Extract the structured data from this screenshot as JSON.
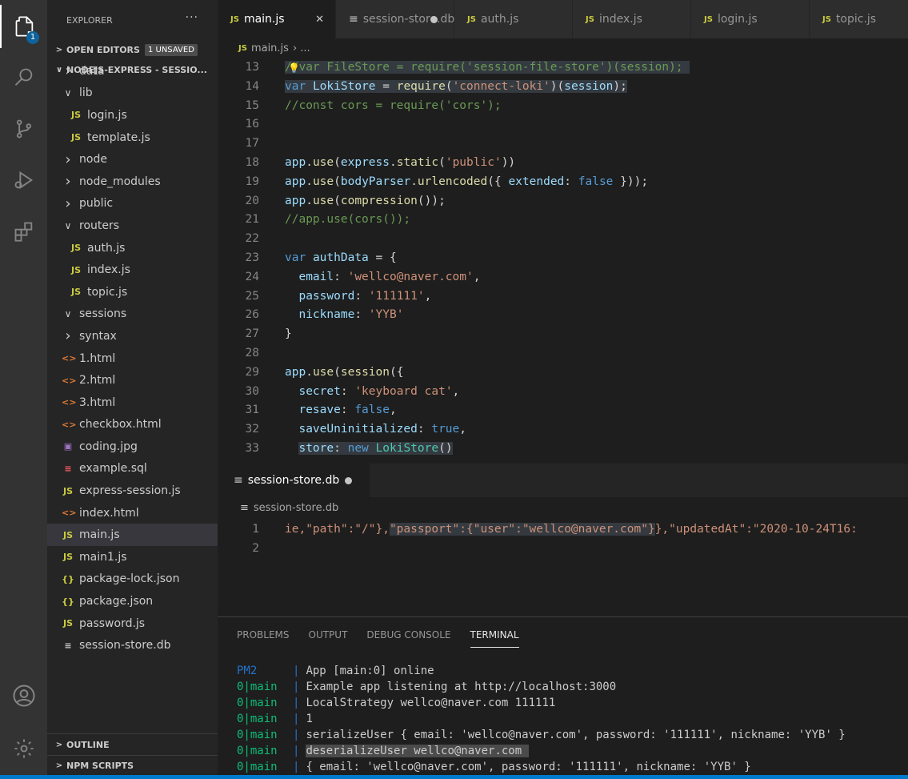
{
  "activity": {
    "explorer_badge": "1"
  },
  "sidebar": {
    "title": "EXPLORER",
    "more": "···",
    "open_editors": {
      "label": "OPEN EDITORS",
      "badge": "1 UNSAVED"
    },
    "project": {
      "label": "NODEJS-EXPRESS - SESSIO..."
    },
    "tree": [
      {
        "label": "data",
        "kind": "folder-closed",
        "depth": 1
      },
      {
        "label": "lib",
        "kind": "folder-open",
        "depth": 1
      },
      {
        "label": "login.js",
        "kind": "js",
        "depth": 2
      },
      {
        "label": "template.js",
        "kind": "js",
        "depth": 2
      },
      {
        "label": "node",
        "kind": "folder-closed",
        "depth": 1
      },
      {
        "label": "node_modules",
        "kind": "folder-closed",
        "depth": 1
      },
      {
        "label": "public",
        "kind": "folder-closed",
        "depth": 1
      },
      {
        "label": "routers",
        "kind": "folder-open",
        "depth": 1
      },
      {
        "label": "auth.js",
        "kind": "js",
        "depth": 2
      },
      {
        "label": "index.js",
        "kind": "js",
        "depth": 2
      },
      {
        "label": "topic.js",
        "kind": "js",
        "depth": 2
      },
      {
        "label": "sessions",
        "kind": "folder-open",
        "depth": 1
      },
      {
        "label": "syntax",
        "kind": "folder-closed",
        "depth": 1
      },
      {
        "label": "1.html",
        "kind": "html",
        "depth": 1
      },
      {
        "label": "2.html",
        "kind": "html",
        "depth": 1
      },
      {
        "label": "3.html",
        "kind": "html",
        "depth": 1
      },
      {
        "label": "checkbox.html",
        "kind": "html",
        "depth": 1
      },
      {
        "label": "coding.jpg",
        "kind": "img",
        "depth": 1
      },
      {
        "label": "example.sql",
        "kind": "sql",
        "depth": 1
      },
      {
        "label": "express-session.js",
        "kind": "js",
        "depth": 1
      },
      {
        "label": "index.html",
        "kind": "html",
        "depth": 1
      },
      {
        "label": "main.js",
        "kind": "js",
        "depth": 1,
        "selected": true
      },
      {
        "label": "main1.js",
        "kind": "js",
        "depth": 1
      },
      {
        "label": "package-lock.json",
        "kind": "json",
        "depth": 1
      },
      {
        "label": "package.json",
        "kind": "json",
        "depth": 1
      },
      {
        "label": "password.js",
        "kind": "js",
        "depth": 1
      },
      {
        "label": "session-store.db",
        "kind": "db",
        "depth": 1
      }
    ],
    "outline": "OUTLINE",
    "npm_scripts": "NPM SCRIPTS"
  },
  "tabs": [
    {
      "label": "main.js",
      "icon": "JS",
      "active": true,
      "state": "close"
    },
    {
      "label": "session-store.db",
      "icon": "≡",
      "active": false,
      "state": "dirty"
    },
    {
      "label": "auth.js",
      "icon": "JS",
      "active": false
    },
    {
      "label": "index.js",
      "icon": "JS",
      "active": false
    },
    {
      "label": "login.js",
      "icon": "JS",
      "active": false
    },
    {
      "label": "topic.js",
      "icon": "JS",
      "active": false
    }
  ],
  "breadcrumb": {
    "icon": "JS",
    "file": "main.js",
    "tail": "› ..."
  },
  "editor": {
    "lines": [
      {
        "n": "13",
        "html": "<span class=\"hl\"><span class=\"cm\">//var FileStore = require('session-file-store')(session);</span> </span>"
      },
      {
        "n": "14",
        "html": "<span class=\"hl\"><span class=\"kw\">var</span> <span class=\"prop\">LokiStore</span> = <span class=\"fn\">require</span>(<span class=\"str\">'connect-loki'</span>)(<span class=\"prop\">session</span>);</span>"
      },
      {
        "n": "15",
        "html": "<span class=\"cm\">//const cors = require('cors');</span>"
      },
      {
        "n": "16",
        "html": ""
      },
      {
        "n": "17",
        "html": ""
      },
      {
        "n": "18",
        "html": "<span class=\"prop\">app</span>.<span class=\"fn\">use</span>(<span class=\"prop\">express</span>.<span class=\"fn\">static</span>(<span class=\"str\">'public'</span>))"
      },
      {
        "n": "19",
        "html": "<span class=\"prop\">app</span>.<span class=\"fn\">use</span>(<span class=\"prop\">bodyParser</span>.<span class=\"fn\">urlencoded</span>({ <span class=\"prop\">extended</span>: <span class=\"kw\">false</span> }));"
      },
      {
        "n": "20",
        "html": "<span class=\"prop\">app</span>.<span class=\"fn\">use</span>(<span class=\"fn\">compression</span>());"
      },
      {
        "n": "21",
        "html": "<span class=\"cm\">//app.use(cors());</span>"
      },
      {
        "n": "22",
        "html": ""
      },
      {
        "n": "23",
        "html": "<span class=\"kw\">var</span> <span class=\"prop\">authData</span> = {"
      },
      {
        "n": "24",
        "html": "  <span class=\"prop\">email</span>: <span class=\"str\">'wellco@naver.com'</span>,"
      },
      {
        "n": "25",
        "html": "  <span class=\"prop\">password</span>: <span class=\"str\">'111111'</span>,"
      },
      {
        "n": "26",
        "html": "  <span class=\"prop\">nickname</span>: <span class=\"str\">'YYB'</span>"
      },
      {
        "n": "27",
        "html": "}"
      },
      {
        "n": "28",
        "html": ""
      },
      {
        "n": "29",
        "html": "<span class=\"prop\">app</span>.<span class=\"fn\">use</span>(<span class=\"fn\">session</span>({"
      },
      {
        "n": "30",
        "html": "  <span class=\"prop\">secret</span>: <span class=\"str\">'keyboard cat'</span>,"
      },
      {
        "n": "31",
        "html": "  <span class=\"prop\">resave</span>: <span class=\"kw\">false</span>,"
      },
      {
        "n": "32",
        "html": "  <span class=\"prop\">saveUninitialized</span>: <span class=\"kw\">true</span>,"
      },
      {
        "n": "33",
        "html": "  <span class=\"hl\"><span class=\"prop\">store</span>: <span class=\"kw\">new</span> <span class=\"cls\">LokiStore</span>()</span>"
      }
    ]
  },
  "editor2": {
    "tab": {
      "icon": "≡",
      "label": "session-store.db"
    },
    "breadcrumb": {
      "icon": "≡",
      "file": "session-store.db"
    },
    "lines": [
      {
        "n": "1",
        "html": "<span class=\"jstr\">ie,\"path\":\"/\"},</span><span class=\"hl\"><span class=\"jstr\">\"passport\":{\"user\":\"wellco@naver.com\"}</span></span><span class=\"jstr\">},\"updatedAt\":\"2020-10-24T16:</span>"
      },
      {
        "n": "2",
        "html": ""
      }
    ]
  },
  "panel": {
    "tabs": [
      {
        "label": "PROBLEMS",
        "active": false
      },
      {
        "label": "OUTPUT",
        "active": false
      },
      {
        "label": "DEBUG CONSOLE",
        "active": false
      },
      {
        "label": "TERMINAL",
        "active": true
      }
    ],
    "terminal": [
      {
        "prefix": "PM2",
        "text": "App [main:0] online"
      },
      {
        "prefix": "0|main",
        "text": "Example app listening at http://localhost:3000"
      },
      {
        "prefix": "0|main",
        "text": "LocalStrategy wellco@naver.com 111111"
      },
      {
        "prefix": "0|main",
        "text": "1"
      },
      {
        "prefix": "0|main",
        "text": "serializeUser { email: 'wellco@naver.com', password: '111111', nickname: 'YYB' }"
      },
      {
        "prefix": "0|main",
        "text": "deserializeUser wellco@naver.com ",
        "highlight": true
      },
      {
        "prefix": "0|main",
        "text": "{ email: 'wellco@naver.com', password: '111111', nickname: 'YYB' }"
      }
    ]
  },
  "colors": {
    "activity_bg": "#333333",
    "sidebar_bg": "#252526",
    "editor_bg": "#1e1e1e",
    "status_bg": "#007acc",
    "js_icon": "#cbcb41",
    "html_icon": "#e37933"
  }
}
